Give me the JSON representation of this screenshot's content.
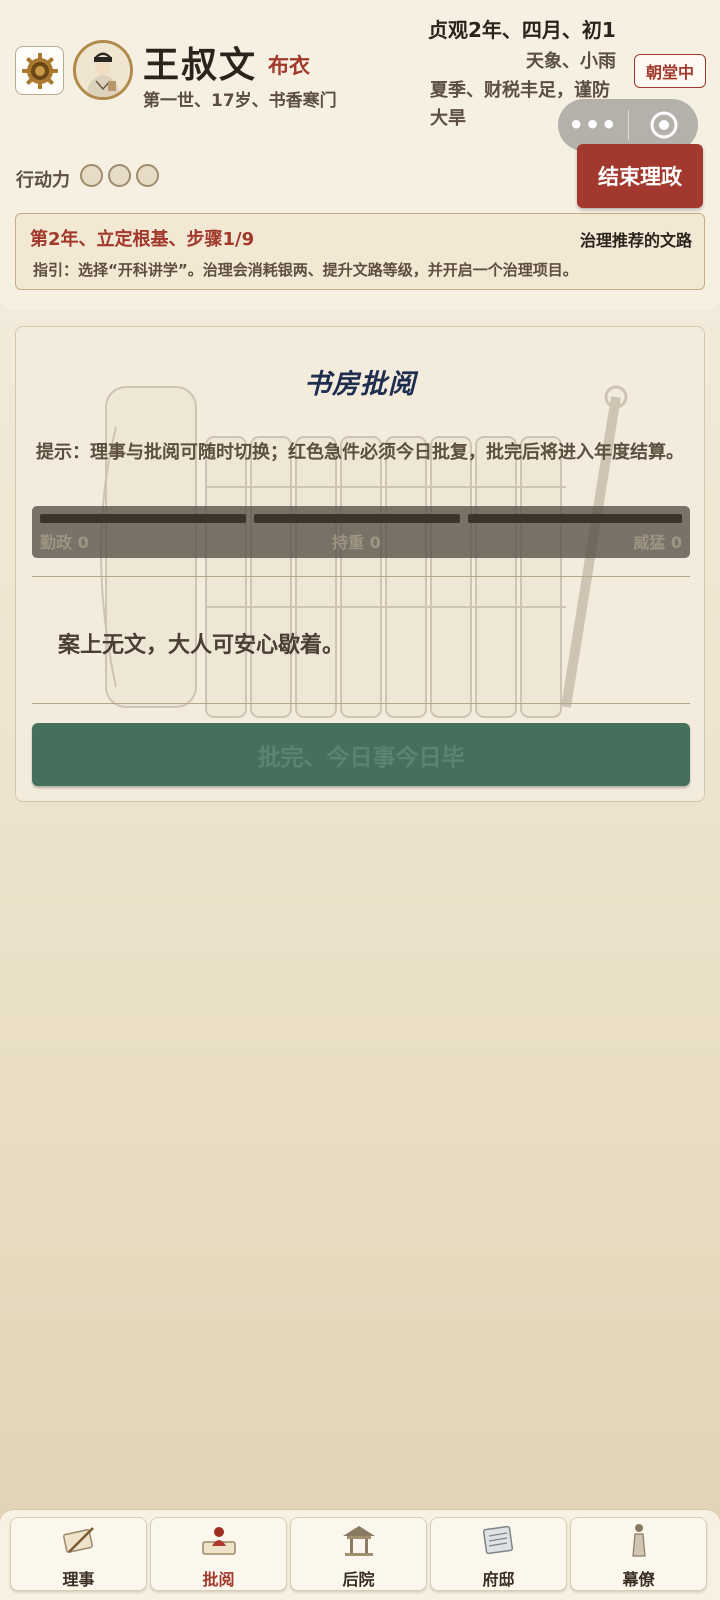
{
  "header": {
    "name": "王叔文",
    "rank": "布衣",
    "subinfo": "第一世、17岁、书香寒门",
    "date": "贞观2年、四月、初1",
    "weather": "天象、小雨",
    "season_note": "夏季、财税丰足，谨防大旱",
    "court_status": "朝堂中",
    "end_button": "结束理政",
    "action_label": "行动力",
    "action_points": 3,
    "capsule_dots": "•••"
  },
  "guide": {
    "step": "第2年、立定根基、步骤1/9",
    "recommend": "治理推荐的文路",
    "text": "指引：选择“开科讲学”。治理会消耗银两、提升文路等级，并开启一个治理项目。"
  },
  "study": {
    "title": "书房批阅",
    "hint": "提示：理事与批阅可随时切换；红色急件必须今日批复，批完后将进入年度结算。",
    "stats": [
      {
        "label": "勤政 0"
      },
      {
        "label": "持重 0"
      },
      {
        "label": "威猛 0"
      }
    ],
    "empty_message": "案上无文，大人可安心歇着。",
    "finish_button": "批完、今日事今日毕"
  },
  "nav": {
    "tabs": [
      {
        "label": "理事",
        "icon": "scroll-brush-icon"
      },
      {
        "label": "批阅",
        "icon": "official-reading-icon"
      },
      {
        "label": "后院",
        "icon": "pavilion-icon"
      },
      {
        "label": "府邸",
        "icon": "book-icon"
      },
      {
        "label": "幕僚",
        "icon": "advisor-figure-icon"
      }
    ],
    "active": "批阅"
  },
  "colors": {
    "accent_red": "#a3392e",
    "finish_green": "#45705c",
    "title_blue": "#1f2d4f"
  }
}
